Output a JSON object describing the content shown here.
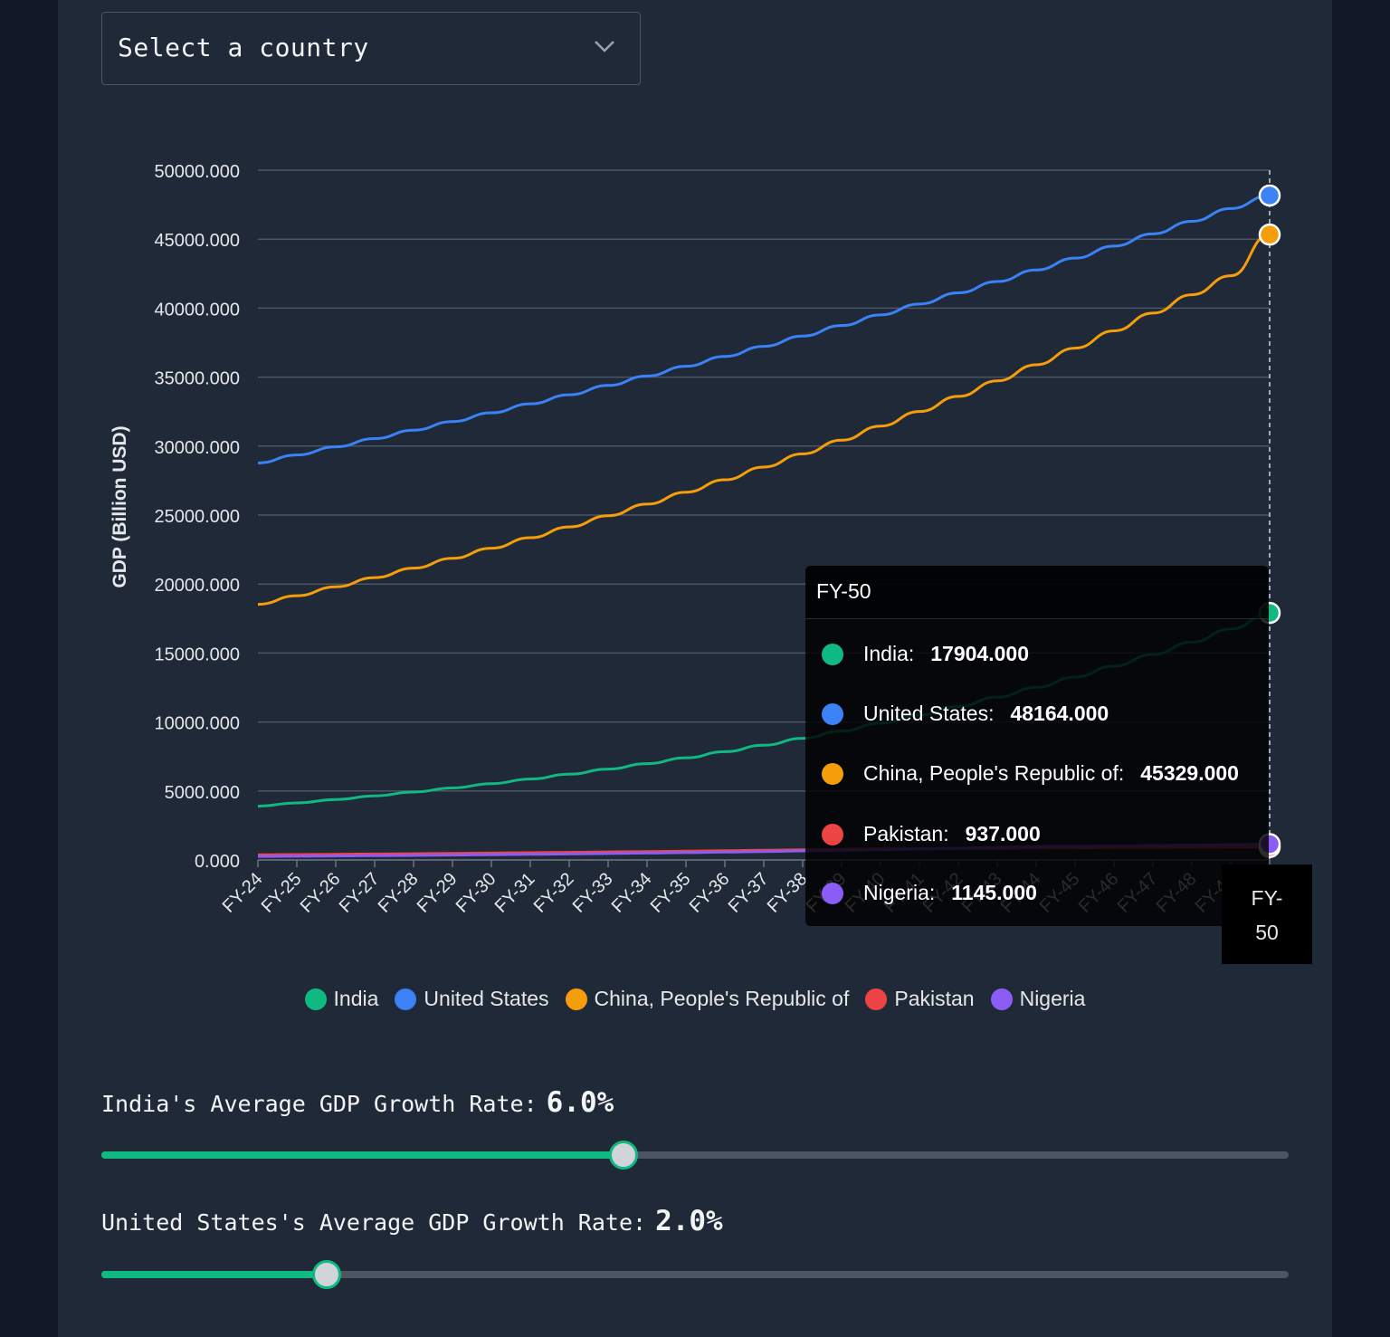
{
  "select": {
    "placeholder": "Select a country"
  },
  "chart_data": {
    "type": "line",
    "ylabel": "GDP (Billion USD)",
    "ylim": [
      0,
      50000
    ],
    "yticks": [
      "0.000",
      "5000.000",
      "10000.000",
      "15000.000",
      "20000.000",
      "25000.000",
      "30000.000",
      "35000.000",
      "40000.000",
      "45000.000",
      "50000.000"
    ],
    "categories": [
      "FY-24",
      "FY-25",
      "FY-26",
      "FY-27",
      "FY-28",
      "FY-29",
      "FY-30",
      "FY-31",
      "FY-32",
      "FY-33",
      "FY-34",
      "FY-35",
      "FY-36",
      "FY-37",
      "FY-38",
      "FY-39",
      "FY-40",
      "FY-41",
      "FY-42",
      "FY-43",
      "FY-44",
      "FY-45",
      "FY-46",
      "FY-47",
      "FY-48",
      "FY-49",
      "FY-50"
    ],
    "series": [
      {
        "name": "India",
        "color": "#10b981",
        "values": [
          3900,
          4134,
          4382,
          4645,
          4924,
          5219,
          5532,
          5864,
          6216,
          6589,
          6984,
          7403,
          7848,
          8319,
          8818,
          9347,
          9908,
          10502,
          11132,
          11800,
          12508,
          13258,
          14054,
          14897,
          15791,
          16738,
          17904
        ]
      },
      {
        "name": "United States",
        "color": "#3b82f6",
        "values": [
          28781,
          29357,
          29944,
          30543,
          31154,
          31777,
          32412,
          33061,
          33722,
          34396,
          35084,
          35786,
          36502,
          37232,
          37976,
          38736,
          39511,
          40301,
          41107,
          41929,
          42768,
          43623,
          44496,
          45386,
          46293,
          47219,
          48164
        ]
      },
      {
        "name": "China, People's Republic of",
        "color": "#f59e0b",
        "values": [
          18532,
          19155,
          19799,
          20464,
          21152,
          21863,
          22598,
          23357,
          24142,
          24953,
          25792,
          26659,
          27555,
          28481,
          29438,
          30428,
          31450,
          32507,
          33600,
          34729,
          35896,
          37102,
          38349,
          39638,
          40970,
          42347,
          45329
        ]
      },
      {
        "name": "Pakistan",
        "color": "#ef4444",
        "values": [
          374,
          393,
          413,
          433,
          455,
          478,
          502,
          527,
          553,
          581,
          610,
          640,
          672,
          706,
          741,
          778,
          800,
          815,
          830,
          846,
          862,
          878,
          894,
          904,
          915,
          926,
          937
        ]
      },
      {
        "name": "Nigeria",
        "color": "#8b5cf6",
        "values": [
          253,
          271,
          290,
          310,
          332,
          355,
          380,
          407,
          435,
          466,
          498,
          533,
          571,
          611,
          653,
          699,
          748,
          800,
          856,
          916,
          980,
          1000,
          1025,
          1050,
          1080,
          1110,
          1145
        ]
      }
    ]
  },
  "tooltip": {
    "title": "FY-50",
    "rows": [
      {
        "label": "India:",
        "value": "17904.000",
        "color": "#10b981"
      },
      {
        "label": "United States:",
        "value": "48164.000",
        "color": "#3b82f6"
      },
      {
        "label": "China, People's Republic of:",
        "value": "45329.000",
        "color": "#f59e0b"
      },
      {
        "label": "Pakistan:",
        "value": "937.000",
        "color": "#ef4444"
      },
      {
        "label": "Nigeria:",
        "value": "1145.000",
        "color": "#8b5cf6"
      }
    ]
  },
  "xaxis_tooltip": {
    "line1": "FY-",
    "line2": "50"
  },
  "sliders": [
    {
      "label": "India's Average GDP Growth Rate:",
      "value_text": "6.0%",
      "fraction": 0.44
    },
    {
      "label": "United States's Average GDP Growth Rate:",
      "value_text": "2.0%",
      "fraction": 0.19
    }
  ]
}
